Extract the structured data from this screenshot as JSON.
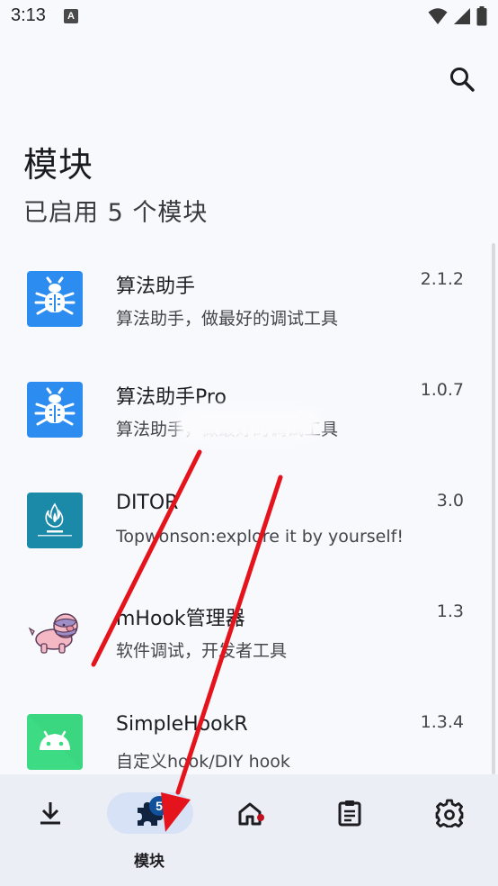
{
  "status_bar": {
    "time": "3:13",
    "notification_icon_letter": "A"
  },
  "header": {
    "title": "模块",
    "subtitle": "已启用 5 个模块"
  },
  "modules": [
    {
      "name": "算法助手",
      "description": "算法助手，做最好的调试工具",
      "version": "2.1.2",
      "icon": "bug-icon"
    },
    {
      "name": "算法助手Pro",
      "description": "算法助手，做最好的调试工具",
      "version": "1.0.7",
      "icon": "bug-icon"
    },
    {
      "name": "DITOR",
      "description": "Topwonson:explore it by yourself!",
      "version": "3.0",
      "icon": "ditor-logo-icon"
    },
    {
      "name": "mHook管理器",
      "description": "软件调试，开发者工具",
      "version": "1.3",
      "icon": "pig-mascot-icon"
    },
    {
      "name": "SimpleHookR",
      "description": "自定义hook/DIY hook",
      "version": "1.3.4",
      "icon": "android-robot-icon"
    }
  ],
  "bottom_nav": {
    "items": [
      {
        "id": "download",
        "icon": "download-icon"
      },
      {
        "id": "modules",
        "icon": "puzzle-icon",
        "label": "模块",
        "badge": "5",
        "active": true
      },
      {
        "id": "home",
        "icon": "home-icon",
        "has_dot": true
      },
      {
        "id": "logs",
        "icon": "clipboard-icon"
      },
      {
        "id": "settings",
        "icon": "gear-icon"
      }
    ]
  },
  "colors": {
    "accent_blue": "#2d8cf0",
    "nav_pill": "#d7e2f6",
    "badge": "#11509a",
    "annotation_red": "#e5141c",
    "ditor_teal": "#1a8aa8",
    "android_green": "#3ddc84"
  }
}
